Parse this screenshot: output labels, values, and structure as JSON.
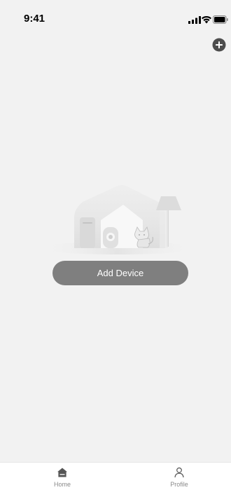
{
  "status_bar": {
    "time": "9:41"
  },
  "main": {
    "add_device_label": "Add Device"
  },
  "tab_bar": {
    "tabs": [
      {
        "label": "Home",
        "icon": "home-icon",
        "active": true
      },
      {
        "label": "Profile",
        "icon": "profile-icon",
        "active": false
      }
    ]
  },
  "colors": {
    "background": "#f2f2f2",
    "button": "#7f7f7f",
    "button_text": "#ffffff",
    "tab_label": "#8a8a8a",
    "tab_active_icon": "#555555"
  }
}
